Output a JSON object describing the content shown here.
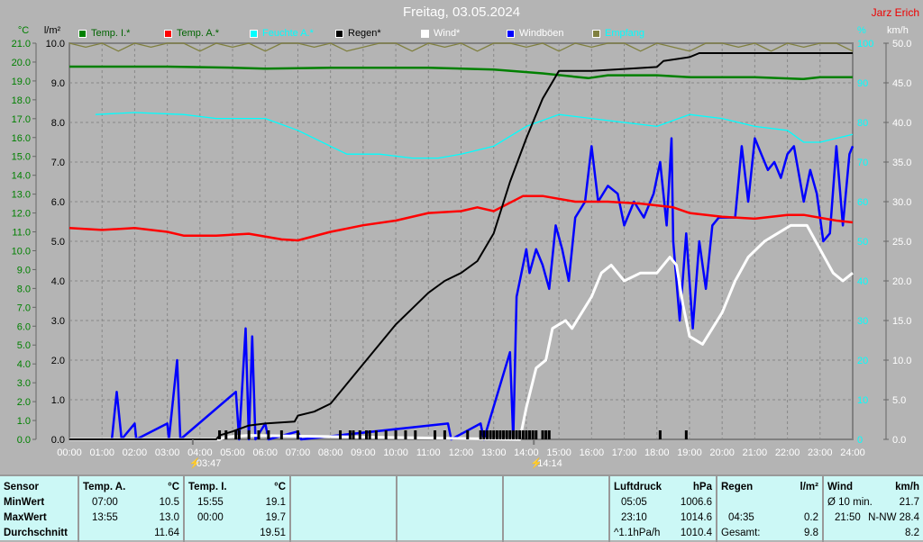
{
  "header": {
    "title": "Freitag, 03.05.2024",
    "author": "Jarz Erich"
  },
  "legend": [
    {
      "label": "Temp. I.*",
      "color": "#008000",
      "text_color": "#006400"
    },
    {
      "label": "Temp. A.*",
      "color": "#ff0000",
      "text_color": "#006400"
    },
    {
      "label": "Feuchte A.*",
      "color": "#00ffff",
      "text_color": "#00ffff"
    },
    {
      "label": "Regen*",
      "color": "#000000",
      "text_color": "#000000"
    },
    {
      "label": "Wind*",
      "color": "#ffffff",
      "text_color": "#ffffff"
    },
    {
      "label": "Windböen",
      "color": "#0000ff",
      "text_color": "#ffffff"
    },
    {
      "label": "Empfang",
      "color": "#808040",
      "text_color": "#00ffff"
    }
  ],
  "axes": {
    "temp_unit": "°C",
    "rain_unit": "l/m²",
    "hum_unit": "%",
    "wind_unit": "km/h"
  },
  "markers": [
    {
      "label": "03:47",
      "hour": 3.78,
      "icon": "sunrise-icon"
    },
    {
      "label": "14:14",
      "hour": 14.23,
      "icon": "sunset-icon"
    }
  ],
  "chart_data": {
    "type": "line",
    "x_range": [
      0,
      24
    ],
    "x_ticks": [
      "00:00",
      "01:00",
      "02:00",
      "03:00",
      "04:00",
      "05:00",
      "06:00",
      "07:00",
      "08:00",
      "09:00",
      "10:00",
      "11:00",
      "12:00",
      "13:00",
      "14:00",
      "15:00",
      "16:00",
      "17:00",
      "18:00",
      "19:00",
      "20:00",
      "21:00",
      "22:00",
      "23:00",
      "24:00"
    ],
    "temp_axis": {
      "range": [
        0,
        21
      ],
      "step": 1
    },
    "rain_axis": {
      "range": [
        0,
        10
      ],
      "step": 1
    },
    "hum_axis": {
      "range": [
        0,
        100
      ],
      "step": 10
    },
    "wind_axis": {
      "range": [
        0,
        50
      ],
      "step": 5
    },
    "series": {
      "temp_in": [
        [
          0,
          19.76
        ],
        [
          3,
          19.76
        ],
        [
          5,
          19.7
        ],
        [
          6,
          19.65
        ],
        [
          8,
          19.7
        ],
        [
          11,
          19.7
        ],
        [
          13,
          19.6
        ],
        [
          14.5,
          19.4
        ],
        [
          15.9,
          19.15
        ],
        [
          16.5,
          19.3
        ],
        [
          18,
          19.3
        ],
        [
          19,
          19.2
        ],
        [
          21,
          19.2
        ],
        [
          22.5,
          19.1
        ],
        [
          23,
          19.2
        ],
        [
          24,
          19.2
        ]
      ],
      "temp_out": [
        [
          0,
          11.2
        ],
        [
          1,
          11.1
        ],
        [
          2,
          11.2
        ],
        [
          3,
          11.0
        ],
        [
          3.5,
          10.8
        ],
        [
          4.5,
          10.8
        ],
        [
          5.5,
          10.9
        ],
        [
          6.5,
          10.6
        ],
        [
          7,
          10.55
        ],
        [
          8,
          11.0
        ],
        [
          9,
          11.35
        ],
        [
          10,
          11.6
        ],
        [
          11,
          12.0
        ],
        [
          12,
          12.1
        ],
        [
          12.5,
          12.3
        ],
        [
          13,
          12.1
        ],
        [
          13.9,
          12.9
        ],
        [
          14.5,
          12.9
        ],
        [
          15.5,
          12.6
        ],
        [
          16.5,
          12.6
        ],
        [
          17.5,
          12.5
        ],
        [
          18.5,
          12.3
        ],
        [
          19,
          12.0
        ],
        [
          20,
          11.8
        ],
        [
          21,
          11.7
        ],
        [
          22,
          11.9
        ],
        [
          22.5,
          11.9
        ],
        [
          23.5,
          11.6
        ],
        [
          24,
          11.5
        ]
      ],
      "humidity": [
        [
          0.8,
          82
        ],
        [
          2,
          82.5
        ],
        [
          3.5,
          82
        ],
        [
          4.5,
          81
        ],
        [
          6,
          81
        ],
        [
          7,
          78
        ],
        [
          8,
          74
        ],
        [
          8.5,
          72
        ],
        [
          9.5,
          72
        ],
        [
          10.5,
          71
        ],
        [
          11.3,
          71
        ],
        [
          12,
          72
        ],
        [
          13,
          74
        ],
        [
          14,
          79
        ],
        [
          15,
          82
        ],
        [
          16,
          81
        ],
        [
          17,
          80
        ],
        [
          18,
          79
        ],
        [
          19,
          82
        ],
        [
          20,
          81
        ],
        [
          21,
          79
        ],
        [
          22,
          78
        ],
        [
          22.5,
          75
        ],
        [
          23,
          75
        ],
        [
          24,
          77
        ]
      ],
      "rain_total": [
        [
          0,
          0
        ],
        [
          4.5,
          0
        ],
        [
          4.6,
          0.1
        ],
        [
          5,
          0.2
        ],
        [
          5.5,
          0.35
        ],
        [
          6,
          0.4
        ],
        [
          6.9,
          0.45
        ],
        [
          7,
          0.6
        ],
        [
          7.5,
          0.7
        ],
        [
          8,
          0.9
        ],
        [
          8.5,
          1.4
        ],
        [
          9,
          1.9
        ],
        [
          9.5,
          2.4
        ],
        [
          10,
          2.9
        ],
        [
          10.5,
          3.3
        ],
        [
          11,
          3.7
        ],
        [
          11.5,
          4.0
        ],
        [
          12,
          4.2
        ],
        [
          12.5,
          4.5
        ],
        [
          13,
          5.2
        ],
        [
          13.5,
          6.5
        ],
        [
          14,
          7.6
        ],
        [
          14.5,
          8.6
        ],
        [
          15,
          9.3
        ],
        [
          16,
          9.3
        ],
        [
          17,
          9.35
        ],
        [
          18,
          9.4
        ],
        [
          18.2,
          9.55
        ],
        [
          19,
          9.65
        ],
        [
          19.3,
          9.75
        ],
        [
          24,
          9.75
        ]
      ],
      "wind": [
        [
          0,
          0
        ],
        [
          4.6,
          0
        ],
        [
          4.8,
          0.3
        ],
        [
          5.5,
          0.5
        ],
        [
          13.8,
          0
        ],
        [
          14.0,
          4
        ],
        [
          14.3,
          9
        ],
        [
          14.6,
          10
        ],
        [
          14.8,
          14
        ],
        [
          15.2,
          15
        ],
        [
          15.4,
          14
        ],
        [
          16,
          18
        ],
        [
          16.3,
          21
        ],
        [
          16.6,
          22
        ],
        [
          17,
          20
        ],
        [
          17.5,
          21
        ],
        [
          18,
          21
        ],
        [
          18.4,
          23
        ],
        [
          18.6,
          22
        ],
        [
          18.8,
          17
        ],
        [
          19,
          13
        ],
        [
          19.4,
          12
        ],
        [
          19.7,
          14
        ],
        [
          20,
          16
        ],
        [
          20.4,
          20
        ],
        [
          20.8,
          23
        ],
        [
          21.3,
          25
        ],
        [
          21.7,
          26
        ],
        [
          22.1,
          27
        ],
        [
          22.6,
          27
        ],
        [
          23,
          24
        ],
        [
          23.4,
          21
        ],
        [
          23.7,
          20
        ],
        [
          24,
          21
        ]
      ],
      "gusts": [
        [
          0,
          0
        ],
        [
          1.3,
          0
        ],
        [
          1.45,
          6
        ],
        [
          1.6,
          0
        ],
        [
          2,
          2
        ],
        [
          2.05,
          0
        ],
        [
          3,
          2
        ],
        [
          3.05,
          0
        ],
        [
          3.3,
          10
        ],
        [
          3.4,
          0
        ],
        [
          5.1,
          6
        ],
        [
          5.2,
          0
        ],
        [
          5.4,
          14
        ],
        [
          5.5,
          0
        ],
        [
          5.6,
          13
        ],
        [
          5.7,
          0
        ],
        [
          6,
          2
        ],
        [
          6.1,
          0
        ],
        [
          7,
          1
        ],
        [
          7.1,
          0
        ],
        [
          11.6,
          2
        ],
        [
          11.7,
          0
        ],
        [
          12.6,
          2
        ],
        [
          12.7,
          0
        ],
        [
          13.5,
          11
        ],
        [
          13.6,
          0
        ],
        [
          13.7,
          18
        ],
        [
          13.85,
          21
        ],
        [
          14,
          24
        ],
        [
          14.1,
          21
        ],
        [
          14.3,
          24
        ],
        [
          14.5,
          22
        ],
        [
          14.7,
          19
        ],
        [
          14.9,
          27
        ],
        [
          15.1,
          24
        ],
        [
          15.3,
          20
        ],
        [
          15.5,
          28
        ],
        [
          15.8,
          30
        ],
        [
          16,
          37
        ],
        [
          16.2,
          30
        ],
        [
          16.5,
          32
        ],
        [
          16.8,
          31
        ],
        [
          17,
          27
        ],
        [
          17.3,
          30
        ],
        [
          17.6,
          28
        ],
        [
          17.9,
          31
        ],
        [
          18.1,
          35
        ],
        [
          18.3,
          27
        ],
        [
          18.45,
          38
        ],
        [
          18.5,
          25
        ],
        [
          18.7,
          15
        ],
        [
          18.9,
          26
        ],
        [
          19.1,
          14
        ],
        [
          19.3,
          25
        ],
        [
          19.5,
          19
        ],
        [
          19.7,
          27
        ],
        [
          19.9,
          28
        ],
        [
          20.2,
          28
        ],
        [
          20.4,
          28
        ],
        [
          20.6,
          37
        ],
        [
          20.8,
          30
        ],
        [
          21,
          38
        ],
        [
          21.2,
          36
        ],
        [
          21.4,
          34
        ],
        [
          21.6,
          35
        ],
        [
          21.8,
          33
        ],
        [
          22,
          36
        ],
        [
          22.2,
          37
        ],
        [
          22.5,
          30
        ],
        [
          22.7,
          34
        ],
        [
          22.9,
          31
        ],
        [
          23.1,
          25
        ],
        [
          23.3,
          26
        ],
        [
          23.5,
          37
        ],
        [
          23.7,
          27
        ],
        [
          23.9,
          36
        ],
        [
          24,
          37
        ]
      ],
      "reception": [
        100,
        99,
        100,
        98,
        100,
        99,
        100,
        100,
        98,
        100,
        99,
        100,
        98,
        100,
        100,
        99,
        100,
        98,
        99,
        100,
        100,
        98,
        100,
        99,
        100,
        98,
        100,
        100,
        99,
        100,
        98,
        100,
        99,
        100,
        100,
        98,
        100,
        99,
        98,
        100,
        100,
        99,
        100,
        98,
        100,
        99,
        100,
        100,
        98
      ]
    },
    "rain_events_hours": [
      4.6,
      4.8,
      5.1,
      5.2,
      5.5,
      5.8,
      6.1,
      6.5,
      7.0,
      8.3,
      8.6,
      8.7,
      8.9,
      9.1,
      9.2,
      9.4,
      9.7,
      10.0,
      10.3,
      10.6,
      11.2,
      11.5,
      12.2,
      12.6,
      12.7,
      12.8,
      12.9,
      13.0,
      13.1,
      13.2,
      13.3,
      13.4,
      13.5,
      13.6,
      13.7,
      13.8,
      13.9,
      14.0,
      14.1,
      14.2,
      14.3,
      14.5,
      14.6,
      14.7,
      18.1,
      18.9
    ]
  },
  "summary": {
    "sensor": {
      "header": "Sensor",
      "rows": [
        "MinWert",
        "MaxWert",
        "Durchschnitt"
      ]
    },
    "temp_a": {
      "header": "Temp. A.",
      "unit": "°C",
      "min_time": "07:00",
      "min": "10.5",
      "max_time": "13:55",
      "max": "13.0",
      "avg": "11.64"
    },
    "temp_i": {
      "header": "Temp. I.",
      "unit": "°C",
      "min_time": "15:55",
      "min": "19.1",
      "max_time": "00:00",
      "max": "19.7",
      "avg": "19.51"
    },
    "pressure": {
      "header": "Luftdruck",
      "unit": "hPa",
      "min_time": "05:05",
      "min": "1006.6",
      "max_time": "23:10",
      "max": "1014.6",
      "trend": "^1.1hPa/h",
      "avg": "1010.4"
    },
    "rain": {
      "header": "Regen",
      "unit": "l/m²",
      "max_time": "04:35",
      "max": "0.2",
      "total_label": "Gesamt:",
      "total": "9.8"
    },
    "wind": {
      "header": "Wind",
      "unit": "km/h",
      "avg_label": "Ø 10 min.",
      "avg": "21.7",
      "max_time": "21:50",
      "max": "N-NW 28.4",
      "mean": "8.2"
    }
  }
}
